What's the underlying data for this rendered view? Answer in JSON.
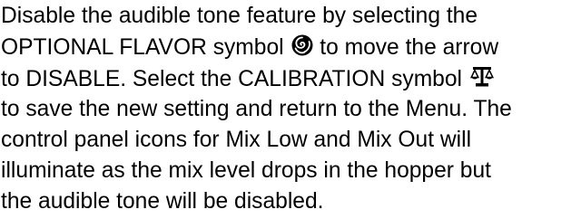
{
  "paragraph": {
    "lines": [
      "Disable the audible tone feature by selecting the",
      "OPTIONAL FLAVOR symbol ",
      " to move the arrow",
      "to DISABLE. Select the CALIBRATION symbol ",
      "to save the new setting and return to the Menu. The",
      "control panel icons for Mix Low and Mix Out will",
      "illuminate as the mix level drops in the hopper but",
      "the audible tone will be disabled."
    ]
  },
  "icons": {
    "optional_flavor": "optional-flavor-icon",
    "calibration": "calibration-icon"
  }
}
